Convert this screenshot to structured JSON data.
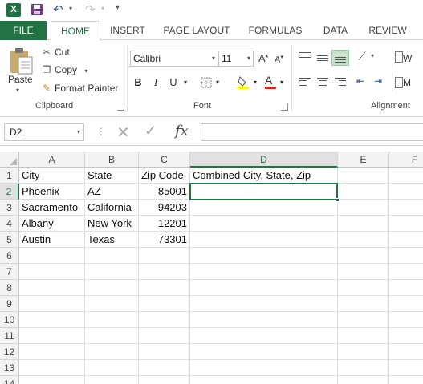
{
  "qat": {
    "app_logo": "X",
    "icons": [
      "excel-logo",
      "save-icon",
      "undo-icon",
      "redo-icon",
      "customize-icon"
    ]
  },
  "tabs": [
    {
      "label": "FILE"
    },
    {
      "label": "HOME",
      "active": true
    },
    {
      "label": "INSERT"
    },
    {
      "label": "PAGE LAYOUT"
    },
    {
      "label": "FORMULAS"
    },
    {
      "label": "DATA"
    },
    {
      "label": "REVIEW"
    }
  ],
  "ribbon": {
    "clipboard": {
      "paste_label": "Paste",
      "cut_label": "Cut",
      "copy_label": "Copy",
      "format_painter_label": "Format Painter",
      "group_label": "Clipboard"
    },
    "font": {
      "font_name": "Calibri",
      "font_size": "11",
      "bold": "B",
      "italic": "I",
      "underline": "U",
      "group_label": "Font"
    },
    "alignment": {
      "wrap_label": "W",
      "merge_label": "M",
      "group_label": "Alignment"
    }
  },
  "formula_bar": {
    "name_box": "D2",
    "fx_label": "fx",
    "formula": ""
  },
  "sheet": {
    "columns": [
      "A",
      "B",
      "C",
      "D",
      "E",
      "F"
    ],
    "active_column": "D",
    "rows": [
      "1",
      "2",
      "3",
      "4",
      "5",
      "6",
      "7",
      "8",
      "9",
      "10",
      "11",
      "12",
      "13",
      "14"
    ],
    "active_row": "2",
    "cells": {
      "r1": {
        "a": "City",
        "b": "State",
        "c": "Zip Code",
        "d": "Combined City, State, Zip"
      },
      "r2": {
        "a": "Phoenix",
        "b": "AZ",
        "c": "85001"
      },
      "r3": {
        "a": "Sacramento",
        "b": "California",
        "c": "94203"
      },
      "r4": {
        "a": "Albany",
        "b": "New York",
        "c": "12201"
      },
      "r5": {
        "a": "Austin",
        "b": "Texas",
        "c": "73301"
      }
    }
  },
  "colors": {
    "accent": "#217346",
    "selection_fill": "#c7e0c9"
  }
}
